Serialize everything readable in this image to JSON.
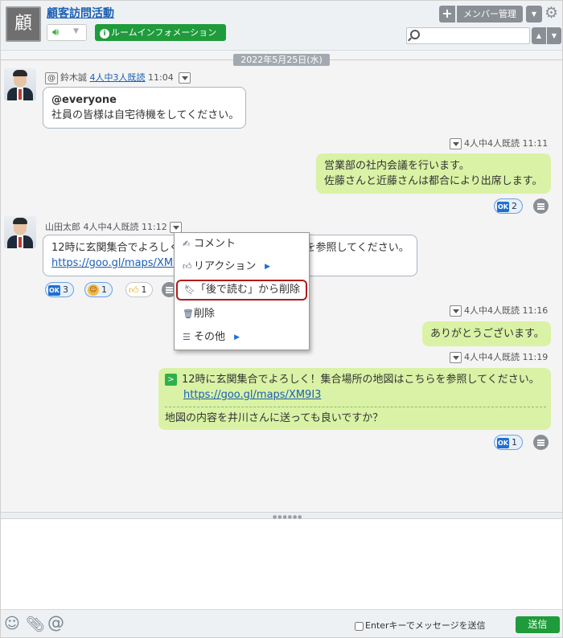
{
  "room": {
    "avatar_char": "顧",
    "title": "顧客訪問活動",
    "info_label": "ルームインフォメーション"
  },
  "header": {
    "member_label": "メンバー管理",
    "search_placeholder": ""
  },
  "date_divider": "2022年5月25日(水)",
  "messages": [
    {
      "sender": "鈴木誠",
      "read": "4人中3人既読",
      "time": "11:04",
      "line1": "@everyone",
      "line2": "社員の皆様は自宅待機をしてください。"
    },
    {
      "read": "4人中4人既読",
      "time": "11:11",
      "line1": "営業部の社内会議を行います。",
      "line2": "佐藤さんと近藤さんは都合により出席します。",
      "ok_count": "2"
    },
    {
      "sender": "山田太郎",
      "read": "4人中4人既読",
      "time": "11:12",
      "line1": "12時に玄関集合でよろしく！集合場所の地図はこちらを参照してください。",
      "link": "https://goo.gl/maps/XM9I3",
      "ok_count": "3",
      "smile_count": "1",
      "thumb_count": "1"
    },
    {
      "read": "4人中4人既読",
      "time": "11:16",
      "line1": "ありがとうございます。"
    },
    {
      "read": "4人中4人既読",
      "time": "11:19",
      "quote": "12時に玄関集合でよろしく！集合場所の地図はこちらを参照してください。",
      "link": "https://goo.gl/maps/XM9I3",
      "line1": "地図の内容を井川さんに送っても良いですか？",
      "ok_count": "1"
    }
  ],
  "context_menu": {
    "comment": "コメント",
    "reaction": "リアクション",
    "remove_read_later": "「後で読む」から削除",
    "delete": "削除",
    "more": "その他"
  },
  "footer": {
    "enter_label": "Enterキーでメッセージを送信",
    "send_label": "送信"
  },
  "icons": {
    "smile": "smile-icon",
    "attach": "paperclip-icon",
    "mention": "at-icon"
  }
}
